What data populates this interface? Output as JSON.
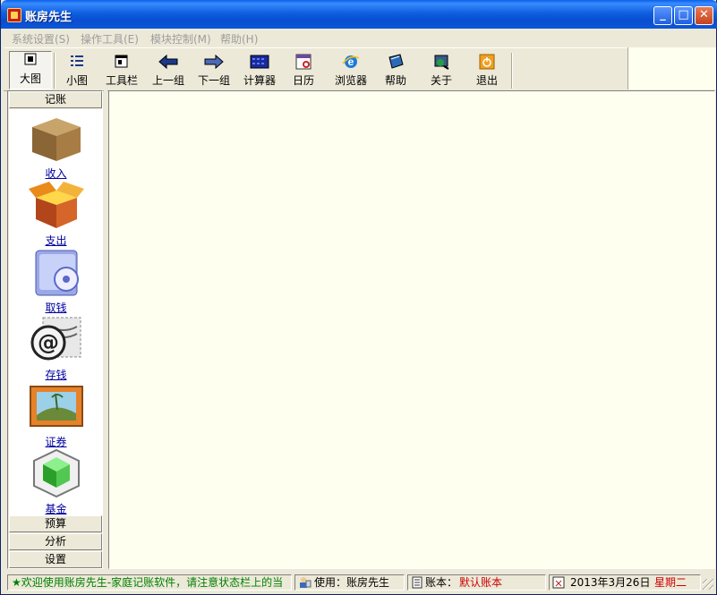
{
  "window": {
    "title": "账房先生"
  },
  "menu": [
    "系统设置(S)",
    "操作工具(E)",
    "模块控制(M)",
    "帮助(H)"
  ],
  "toolbar": [
    {
      "label": "大图",
      "icon": "large-icons-icon"
    },
    {
      "label": "小图",
      "icon": "small-icons-icon"
    },
    {
      "label": "工具栏",
      "icon": "toolbar-icon"
    },
    {
      "label": "上一组",
      "icon": "arrow-left-icon"
    },
    {
      "label": "下一组",
      "icon": "arrow-right-icon"
    },
    {
      "label": "计算器",
      "icon": "calculator-icon"
    },
    {
      "label": "日历",
      "icon": "calendar-icon"
    },
    {
      "label": "浏览器",
      "icon": "ie-browser-icon"
    },
    {
      "label": "帮助",
      "icon": "help-book-icon"
    },
    {
      "label": "关于",
      "icon": "about-icon"
    },
    {
      "label": "退出",
      "icon": "exit-icon"
    }
  ],
  "sidebar": {
    "active_group": "记账",
    "items": [
      {
        "label": "收入",
        "icon": "box-closed-icon"
      },
      {
        "label": "支出",
        "icon": "box-open-icon"
      },
      {
        "label": "取钱",
        "icon": "cd-folder-icon"
      },
      {
        "label": "存钱",
        "icon": "at-stamp-icon"
      },
      {
        "label": "证券",
        "icon": "picture-frame-icon"
      },
      {
        "label": "基金",
        "icon": "green-cubes-icon"
      }
    ],
    "groups": [
      "预算",
      "分析",
      "设置"
    ]
  },
  "status": {
    "message": "★欢迎使用账房先生-家庭记账软件，请注意状态栏上的当",
    "user_label": "使用：账房先生",
    "book_prefix": "账本：",
    "book_name": "默认账本",
    "date": "2013年3月26日",
    "weekday": "星期二"
  },
  "colors": {
    "title_blue": "#0a5fe8",
    "status_green": "#008000",
    "status_red": "#cc0000",
    "link_blue": "#0000a0"
  }
}
